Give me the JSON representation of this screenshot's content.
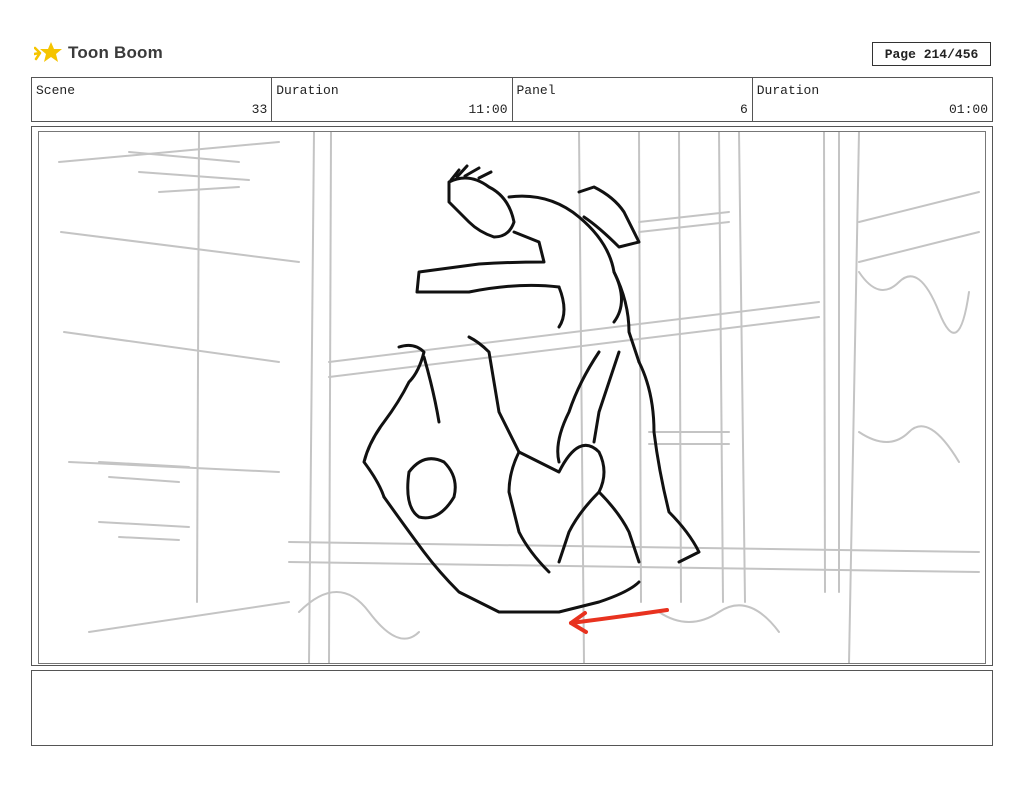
{
  "header": {
    "logo_text": "Toon Boom",
    "page_label": "Page 214/456"
  },
  "info": {
    "scene_label": "Scene",
    "scene_value": "33",
    "duration_label": "Duration",
    "duration_value": "11:00",
    "panel_label": "Panel",
    "panel_value": "6",
    "panel_duration_label": "Duration",
    "panel_duration_value": "01:00"
  },
  "panel": {
    "sketch_icon": "storyboard-sketch",
    "arrow_color": "#e8321f"
  },
  "notes": {
    "text": ""
  },
  "colors": {
    "logo_accent": "#f5c400",
    "sketch_gray": "#c4c4c4",
    "ink": "#111111"
  }
}
